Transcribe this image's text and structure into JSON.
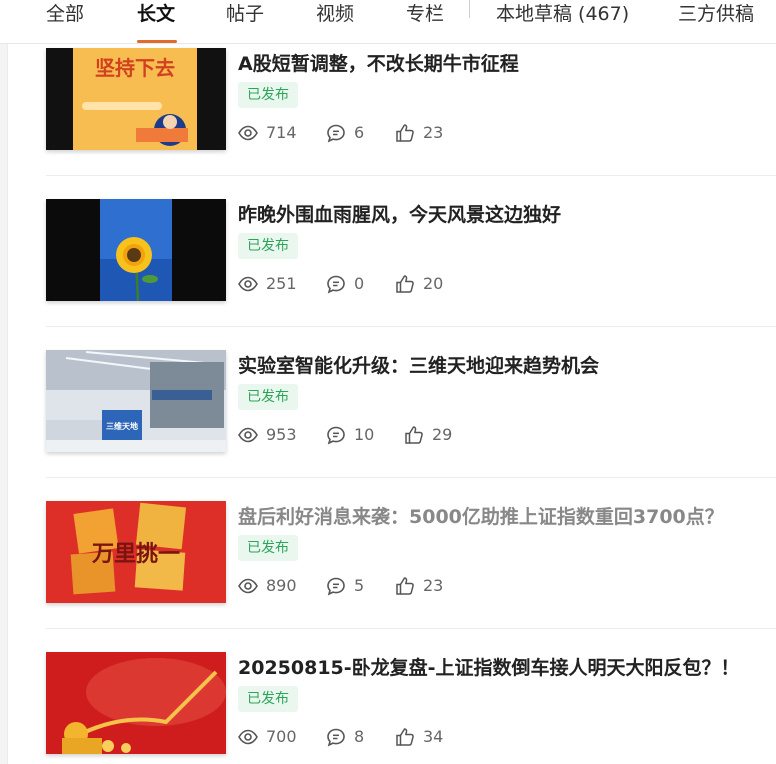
{
  "tabs": [
    {
      "label": "全部"
    },
    {
      "label": "长文"
    },
    {
      "label": "帖子"
    },
    {
      "label": "视频"
    },
    {
      "label": "专栏"
    },
    {
      "label": "本地草稿 (467)"
    },
    {
      "label": "三方供稿"
    }
  ],
  "active_tab": "长文",
  "accent_color": "#e06b2b",
  "badge_color": "#2ea45a",
  "articles": [
    {
      "title": "A股短暂调整，不改长期牛市征程",
      "status": "已发布",
      "views": "714",
      "comments": "6",
      "likes": "23",
      "thumb_text": "坚持下去"
    },
    {
      "title": "昨晚外围血雨腥风，今天风景这边独好",
      "status": "已发布",
      "views": "251",
      "comments": "0",
      "likes": "20",
      "thumb_text": ""
    },
    {
      "title": "实验室智能化升级：三维天地迎来趋势机会",
      "status": "已发布",
      "views": "953",
      "comments": "10",
      "likes": "29",
      "thumb_text": "三维天地"
    },
    {
      "title": "盘后利好消息来袭：5000亿助推上证指数重回3700点？",
      "status": "已发布",
      "views": "890",
      "comments": "5",
      "likes": "23",
      "thumb_text": "万里挑一"
    },
    {
      "title": "20250815-卧龙复盘-上证指数倒车接人明天大阳反包？！",
      "status": "已发布",
      "views": "700",
      "comments": "8",
      "likes": "34",
      "thumb_text": ""
    }
  ]
}
